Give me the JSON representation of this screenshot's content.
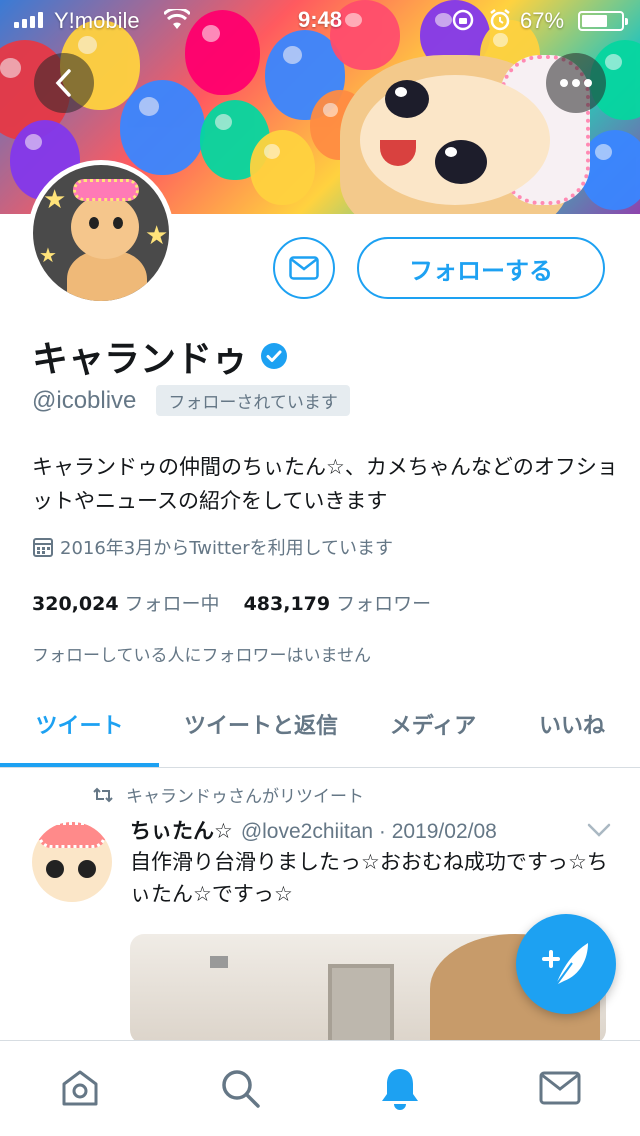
{
  "status_bar": {
    "carrier": "Y!mobile",
    "time": "9:48",
    "battery_percent": "67%",
    "battery_level": 0.67
  },
  "header": {
    "back_icon": "chevron-left-icon",
    "more_icon": "more-horizontal-icon"
  },
  "profile": {
    "display_name": "キャランドゥ",
    "verified": true,
    "handle": "@icoblive",
    "follows_you_label": "フォローされています",
    "bio": "キャランドゥの仲間のちぃたん☆、カメちゃんなどのオフショットやニュースの紹介をしていきます",
    "joined": "2016年3月からTwitterを利用しています",
    "following_count": "320,024",
    "following_label": "フォロー中",
    "followers_count": "483,179",
    "followers_label": "フォロワー",
    "followers_you_know": "フォローしている人にフォロワーはいません"
  },
  "actions": {
    "follow_label": "フォローする",
    "dm_icon": "envelope-icon"
  },
  "tabs": [
    {
      "label": "ツイート",
      "active": true
    },
    {
      "label": "ツイートと返信",
      "active": false
    },
    {
      "label": "メディア",
      "active": false
    },
    {
      "label": "いいね",
      "active": false
    }
  ],
  "tweet": {
    "retweet_context": "キャランドゥさんがリツイート",
    "author_name": "ちぃたん☆",
    "author_handle_date": "@love2chiitan · 2019/02/08",
    "text": "自作滑り台滑りましたっ☆おおむね成功ですっ☆ちぃたん☆ですっ☆"
  },
  "colors": {
    "accent": "#1da1f2",
    "secondary_text": "#657786",
    "primary_text": "#14171a"
  },
  "bottom_nav": [
    {
      "icon": "home-icon"
    },
    {
      "icon": "search-icon"
    },
    {
      "icon": "bell-icon",
      "active": true
    },
    {
      "icon": "mail-icon"
    }
  ]
}
